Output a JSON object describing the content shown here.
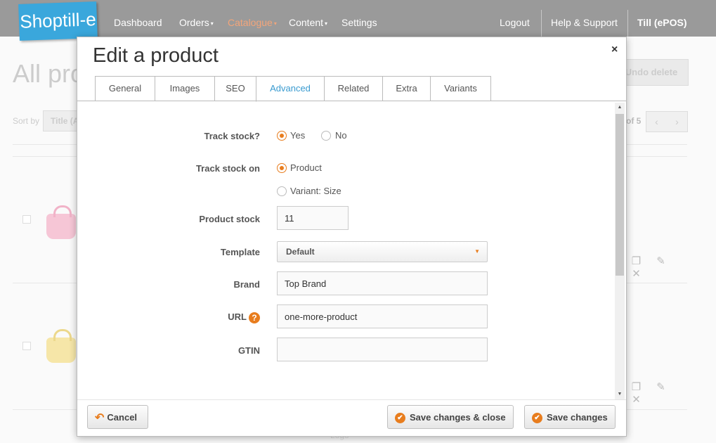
{
  "nav": {
    "logo": "Shoptill-e",
    "items": [
      {
        "label": "Dashboard"
      },
      {
        "label": "Orders",
        "caret": "▾"
      },
      {
        "label": "Catalogue",
        "caret": "▾"
      },
      {
        "label": "Content",
        "caret": "▾"
      },
      {
        "label": "Settings"
      }
    ],
    "right": [
      {
        "label": "Logout"
      },
      {
        "label": "Help & Support"
      },
      {
        "label": "Till (ePOS)"
      }
    ],
    "active_color": "#f3a57a"
  },
  "background": {
    "title": "All pro",
    "undo_label": "Undo delete",
    "sort_label": "Sort by",
    "sort_value": "Title (A",
    "page_of": "of 5",
    "pager_prev": "‹",
    "pager_next": "›",
    "footer": "Logo"
  },
  "modal": {
    "title": "Edit a product",
    "close": "×",
    "tabs": [
      {
        "label": "General",
        "active": false
      },
      {
        "label": "Images",
        "active": false
      },
      {
        "label": "SEO",
        "active": false
      },
      {
        "label": "Advanced",
        "active": true
      },
      {
        "label": "Related",
        "active": false
      },
      {
        "label": "Extra",
        "active": false
      },
      {
        "label": "Variants",
        "active": false
      }
    ],
    "form": {
      "track_stock": {
        "label": "Track stock?",
        "options": [
          "Yes",
          "No"
        ],
        "selected": "Yes"
      },
      "track_stock_on": {
        "label": "Track stock on",
        "options": [
          "Product",
          "Variant: Size"
        ],
        "selected": "Product"
      },
      "product_stock": {
        "label": "Product stock",
        "value": "11"
      },
      "template": {
        "label": "Template",
        "value": "Default"
      },
      "brand": {
        "label": "Brand",
        "value": "Top Brand"
      },
      "url": {
        "label": "URL",
        "help": "?",
        "value": "one-more-product"
      },
      "gtin": {
        "label": "GTIN",
        "value": ""
      }
    },
    "buttons": {
      "cancel": "Cancel",
      "save_close": "Save changes & close",
      "save": "Save changes"
    },
    "accent_color": "#e87d1e",
    "tab_active_color": "#3a9bd0"
  }
}
